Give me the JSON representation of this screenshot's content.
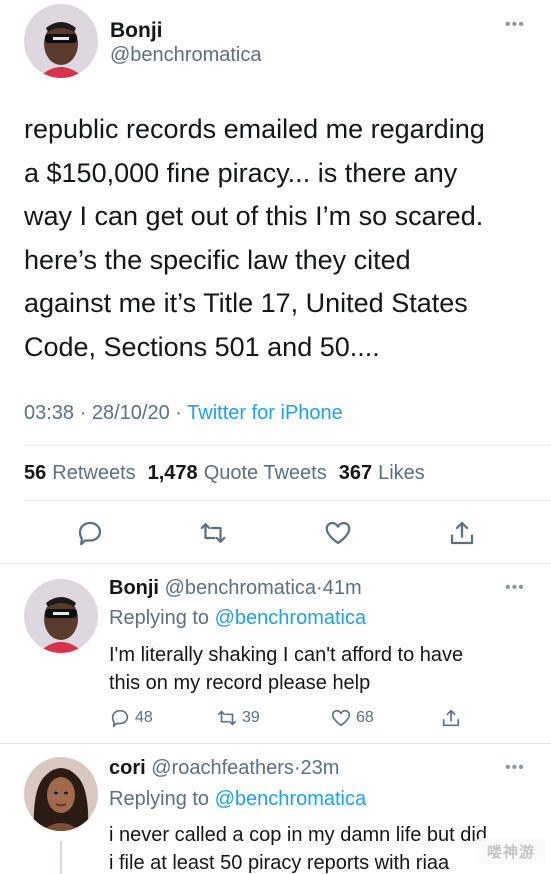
{
  "main_tweet": {
    "display_name": "Bonji",
    "handle": "@benchromatica",
    "text": "republic records emailed me regarding\na $150,000 fine piracy... is there any\nway I can get out of this I’m so scared.\nhere’s the specific law they cited\nagainst me it’s Title 17, United States\nCode, Sections 501 and 50....",
    "time": "03:38",
    "date": "28/10/20",
    "separator": "·",
    "client": "Twitter for iPhone",
    "retweets_count": "56",
    "retweets_label": "Retweets",
    "quote_count": "1,478",
    "quote_label": "Quote Tweets",
    "likes_count": "367",
    "likes_label": "Likes",
    "more_icon": "•••"
  },
  "replies": [
    {
      "display_name": "Bonji",
      "handle": "@benchromatica",
      "age": "41m",
      "replying_prefix": "Replying to",
      "replying_to": "@benchromatica",
      "text": "I'm literally shaking I can't afford to have\nthis on my record please help",
      "reply_count": "48",
      "retweet_count": "39",
      "like_count": "68"
    },
    {
      "display_name": "cori",
      "handle": "@roachfeathers",
      "age": "23m",
      "replying_prefix": "Replying to",
      "replying_to": "@benchromatica",
      "text": "i never called a cop in my damn life but did\ni file at least 50 piracy reports with riaa"
    }
  ],
  "watermark": "喽神游",
  "colors": {
    "accent": "#1da1f2",
    "secondary_text": "#5b7083",
    "divider": "#e1e8ed"
  }
}
